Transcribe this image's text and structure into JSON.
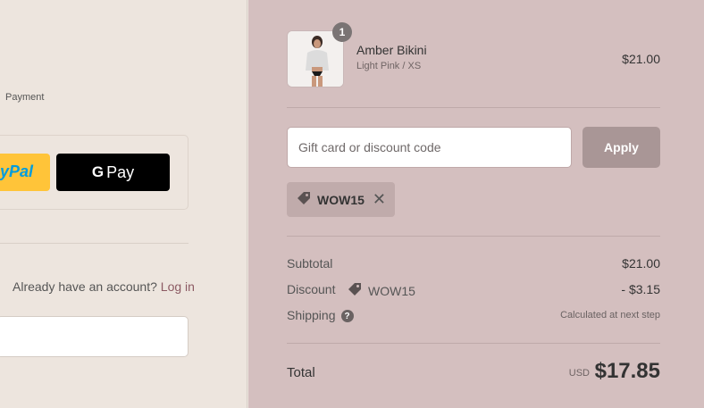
{
  "left": {
    "breadcrumb_payment": "Payment",
    "paypal_label": "yPal",
    "gpay_g": "G",
    "gpay_label": "Pay",
    "account_prompt": "Already have an account?",
    "login_link": "Log in"
  },
  "order": {
    "item": {
      "name": "Amber Bikini",
      "variant": "Light Pink / XS",
      "price": "$21.00",
      "quantity": "1"
    },
    "discount_input": {
      "placeholder": "Gift card or discount code",
      "value": ""
    },
    "apply_label": "Apply",
    "applied_code": "WOW15",
    "subtotal_label": "Subtotal",
    "subtotal_value": "$21.00",
    "discount_label": "Discount",
    "discount_code": "WOW15",
    "discount_value": "- $3.15",
    "shipping_label": "Shipping",
    "shipping_value": "Calculated at next step",
    "total_label": "Total",
    "currency": "USD",
    "total_value": "$17.85"
  },
  "colors": {
    "left_bg": "#ede5de",
    "right_bg": "#d4bfbf",
    "paypal_yellow": "#ffc439",
    "gpay_black": "#000000",
    "apply_button": "#a99696",
    "login_link": "#8c5a63"
  },
  "icons": {
    "tag": "tag-icon",
    "remove": "close-icon",
    "help": "question-icon"
  }
}
